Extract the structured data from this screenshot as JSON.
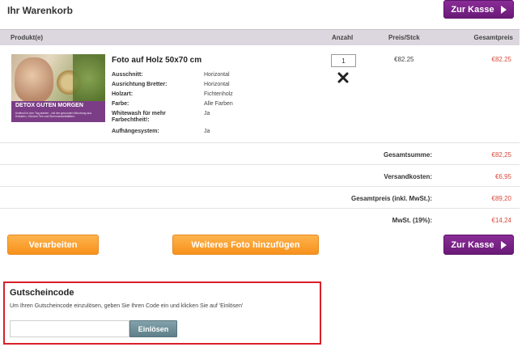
{
  "page_title": "Ihr Warenkorb",
  "checkout_label": "Zur Kasse",
  "table": {
    "headers": {
      "product": "Produkt(e)",
      "quantity": "Anzahl",
      "unit_price": "Preis/Stck",
      "total": "Gesamtpreis"
    }
  },
  "item": {
    "name": "Foto auf Holz 50x70 cm",
    "image": {
      "title": "DETOX GUTEN MORGEN",
      "subtitle": "Kraftvoll in den Tag starten - mit der gesunden Mischung aus Kräutern, Grünem Tee und Brennnesselblättern"
    },
    "attributes": [
      {
        "label": "Ausschnitt:",
        "value": "Horizontal"
      },
      {
        "label": "Ausrichtung Bretter:",
        "value": "Horizontal"
      },
      {
        "label": "Holzart:",
        "value": "Fichtenholz"
      },
      {
        "label": "Farbe:",
        "value": "Alle Farben"
      },
      {
        "label": "Whitewash für mehr Farbechtheit!:",
        "value": "Ja"
      },
      {
        "label": "Aufhängesystem:",
        "value": "Ja"
      }
    ],
    "quantity": "1",
    "unit_price": "€82.25",
    "total_price": "€82.25",
    "remove_icon": "close-x-icon"
  },
  "summary": [
    {
      "label": "Gesamtsumme:",
      "value": "€82,25"
    },
    {
      "label": "Versandkosten:",
      "value": "€6,95"
    },
    {
      "label": "Gesamtpreis (inkl. MwSt.):",
      "value": "€89,20"
    },
    {
      "label": "MwSt. (19%):",
      "value": "€14,24"
    }
  ],
  "actions": {
    "process_label": "Verarbeiten",
    "add_photo_label": "Weiteres Foto hinzufügen"
  },
  "coupon": {
    "title": "Gutscheincode",
    "description": "Um Ihren Gutscheincode einzulösen, geben Sie Ihren Code ein und klicken Sie auf 'Einlösen'",
    "input_value": "",
    "input_placeholder": "",
    "redeem_label": "Einlösen"
  },
  "colors": {
    "checkout_purple": "#7a2288",
    "orange": "#f9a030",
    "price_red": "#d94a3c",
    "highlight_red": "#d8202a",
    "redeem_blue_gray": "#6f8f99"
  }
}
